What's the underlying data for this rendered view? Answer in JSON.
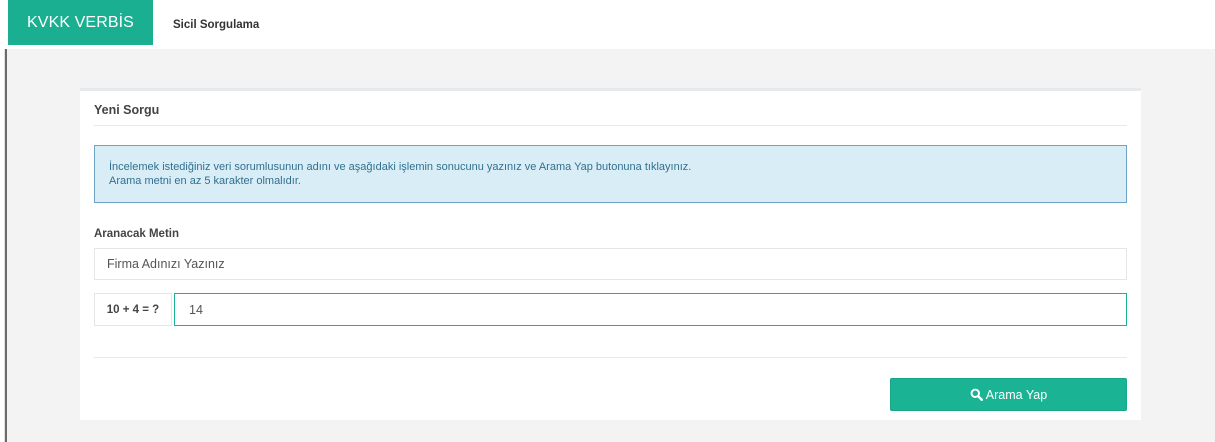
{
  "navbar": {
    "brand": "KVKK VERBİS",
    "link": "Sicil Sorgulama"
  },
  "panel": {
    "title": "Yeni Sorgu",
    "info_line1": "İncelemek istediğiniz veri sorumlusunun adını ve aşağıdaki işlemin sonucunu yazınız ve Arama Yap butonuna tıklayınız.",
    "info_line2": "Arama metni en az 5 karakter olmalıdır."
  },
  "form": {
    "label": "Aranacak Metin",
    "search_placeholder": "Firma Adınızı Yazınız",
    "search_value": "",
    "captcha_label": "10 + 4 = ?",
    "captcha_value": "14",
    "button_label": "Arama Yap",
    "button_icon": "search-icon"
  },
  "colors": {
    "brand": "#1aaf90",
    "info_bg": "#d9edf7",
    "info_border": "#6da3c4",
    "button": "#1ab394"
  }
}
